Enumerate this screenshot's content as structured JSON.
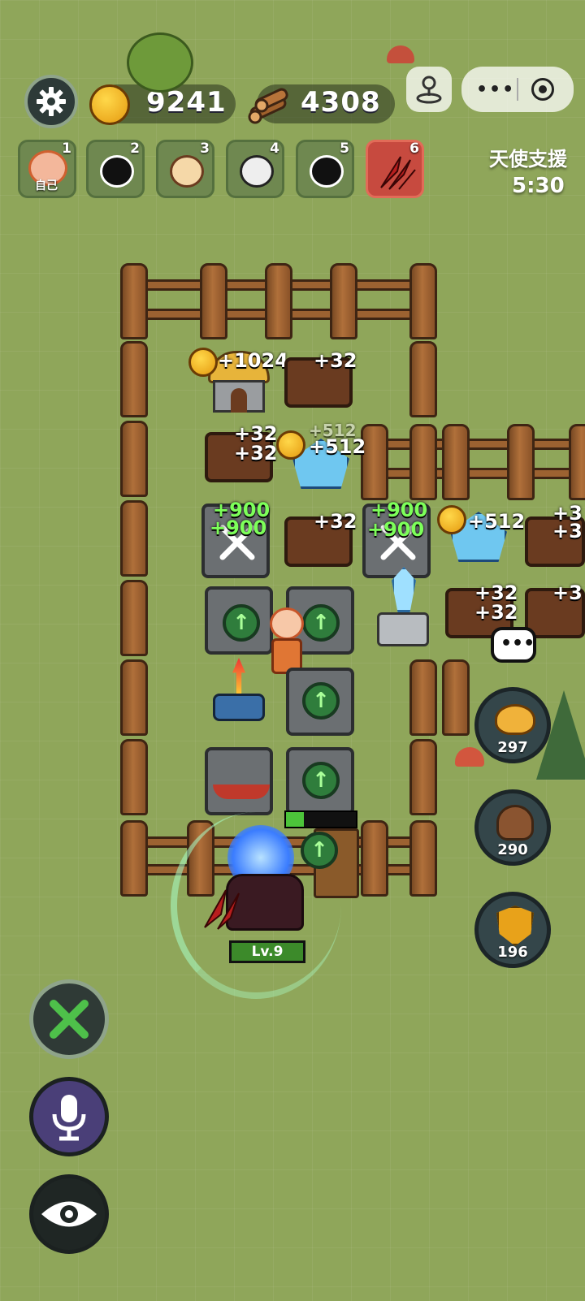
{
  "top_bar": {
    "gold_amount": "9241",
    "wood_amount": "4308"
  },
  "players": [
    {
      "num": "1",
      "tag": "自己",
      "active": false
    },
    {
      "num": "2",
      "tag": "",
      "active": false
    },
    {
      "num": "3",
      "tag": "",
      "active": false
    },
    {
      "num": "4",
      "tag": "",
      "active": false
    },
    {
      "num": "5",
      "tag": "",
      "active": false
    },
    {
      "num": "6",
      "tag": "",
      "active": true
    }
  ],
  "angel_support": {
    "title": "天使支援",
    "timer": "5:30"
  },
  "floaters": {
    "house_gold": "+1024",
    "crate1_wood": "+32",
    "crate2_wood_a": "+32",
    "crate2_wood_b": "+32",
    "crystal1_gold": "+512",
    "crystal1_gold_ghost": "+512",
    "wrench1_a": "+900",
    "wrench1_b": "+900",
    "crate3_wood": "+32",
    "wrench2_a": "+900",
    "wrench2_b": "+900",
    "crystal2_gold": "+512",
    "crate4_wood_a": "+32",
    "crate4_wood_b": "+32",
    "edge_a": "+3",
    "edge_b": "+3",
    "edge_c": "+3"
  },
  "enemy": {
    "level": "Lv.9"
  },
  "side_resources": {
    "piggy": "297",
    "poop": "290",
    "shield": "196"
  },
  "colors": {
    "grass": "#8fa65a",
    "active_player": "#c74a3f",
    "green_float": "#7dff5a"
  },
  "icons": [
    "gear-icon",
    "gold-coin-icon",
    "wood-log-icon",
    "joystick-icon",
    "more-icon",
    "record-icon",
    "chat-icon",
    "piggy-bank-icon",
    "poop-icon",
    "shield-icon",
    "build-tools-icon",
    "microphone-icon",
    "eye-icon"
  ]
}
